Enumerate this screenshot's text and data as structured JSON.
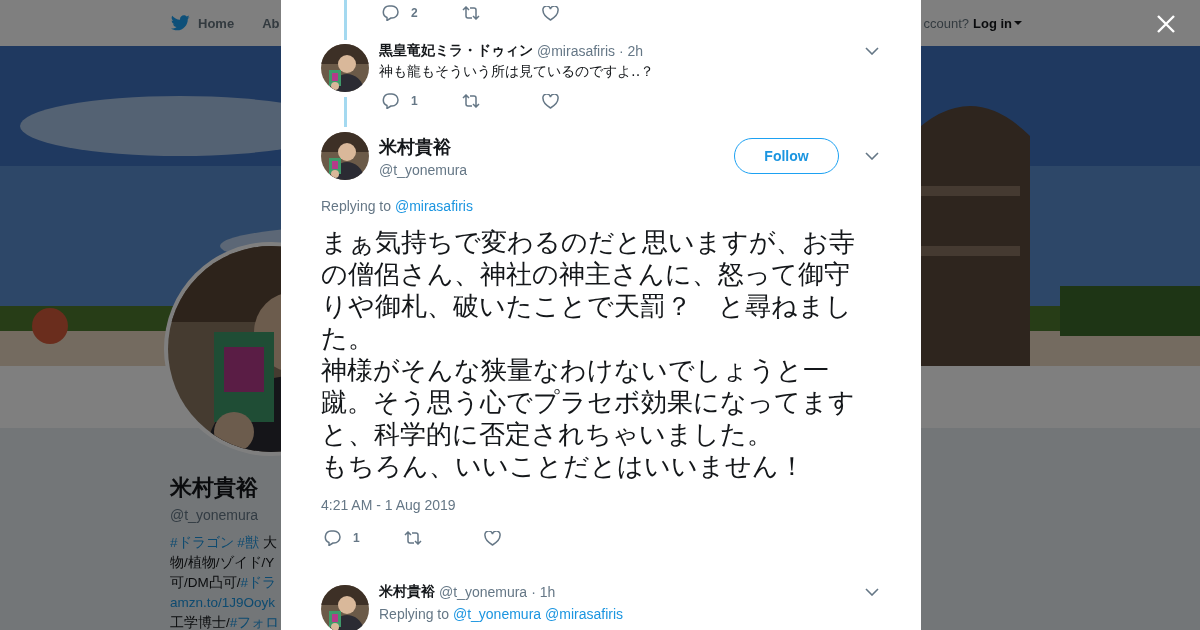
{
  "header": {
    "nav": [
      {
        "label": "Home",
        "kind": "home"
      },
      {
        "label": "Ab",
        "kind": "plain"
      }
    ],
    "account_prompt": "ccount?",
    "login": "Log in"
  },
  "profile": {
    "name": "米村貴裕",
    "handle": "@t_yonemura",
    "bio_lines": [
      [
        {
          "text": "#ドラゴン ",
          "link": true
        },
        {
          "text": "#獣 ",
          "link": true
        },
        {
          "text": "大",
          "link": false
        }
      ],
      [
        {
          "text": "物/植物/ゾイド/Y",
          "link": false
        }
      ],
      [
        {
          "text": "可/DM凸可/",
          "link": false
        },
        {
          "text": "#ドラ",
          "link": true
        }
      ],
      [
        {
          "text": "amzn.to/1J9Ooyk",
          "link": true
        }
      ],
      [
        {
          "text": "工学博士/",
          "link": false
        },
        {
          "text": "#フォロ",
          "link": true
        }
      ]
    ]
  },
  "thread": {
    "top_actions": {
      "replies": "2"
    },
    "reply": {
      "name": "黒皇竜妃ミラ・ドゥィン",
      "handle": "@mirasafiris",
      "time": "· 2h",
      "text": "神も龍もそういう所は見ているのですよ‥？",
      "replies": "1"
    },
    "main": {
      "name": "米村貴裕",
      "handle": "@t_yonemura",
      "follow": "Follow",
      "replying_label": "Replying to",
      "replying_to": [
        "@mirasafiris"
      ],
      "text_lines": [
        "まぁ気持ちで変わるのだと思いますが、お寺",
        "の僧侶さん、神社の神主さんに、怒って御守",
        "りや御札、破いたことで天罰？　と尋ねまし",
        "た。",
        "神様がそんな狭量なわけないでしょうと一",
        "蹴。そう思う心でプラセボ効果になってます",
        "と、科学的に否定されちゃいました。",
        "もちろん、いいことだとはいいません！"
      ],
      "timestamp": "4:21 AM - 1 Aug 2019",
      "replies": "1"
    },
    "next": {
      "name": "米村貴裕",
      "handle": "@t_yonemura",
      "time": "· 1h",
      "replying_label": "Replying to",
      "replying_to": [
        "@t_yonemura",
        "@mirasafiris"
      ]
    }
  }
}
